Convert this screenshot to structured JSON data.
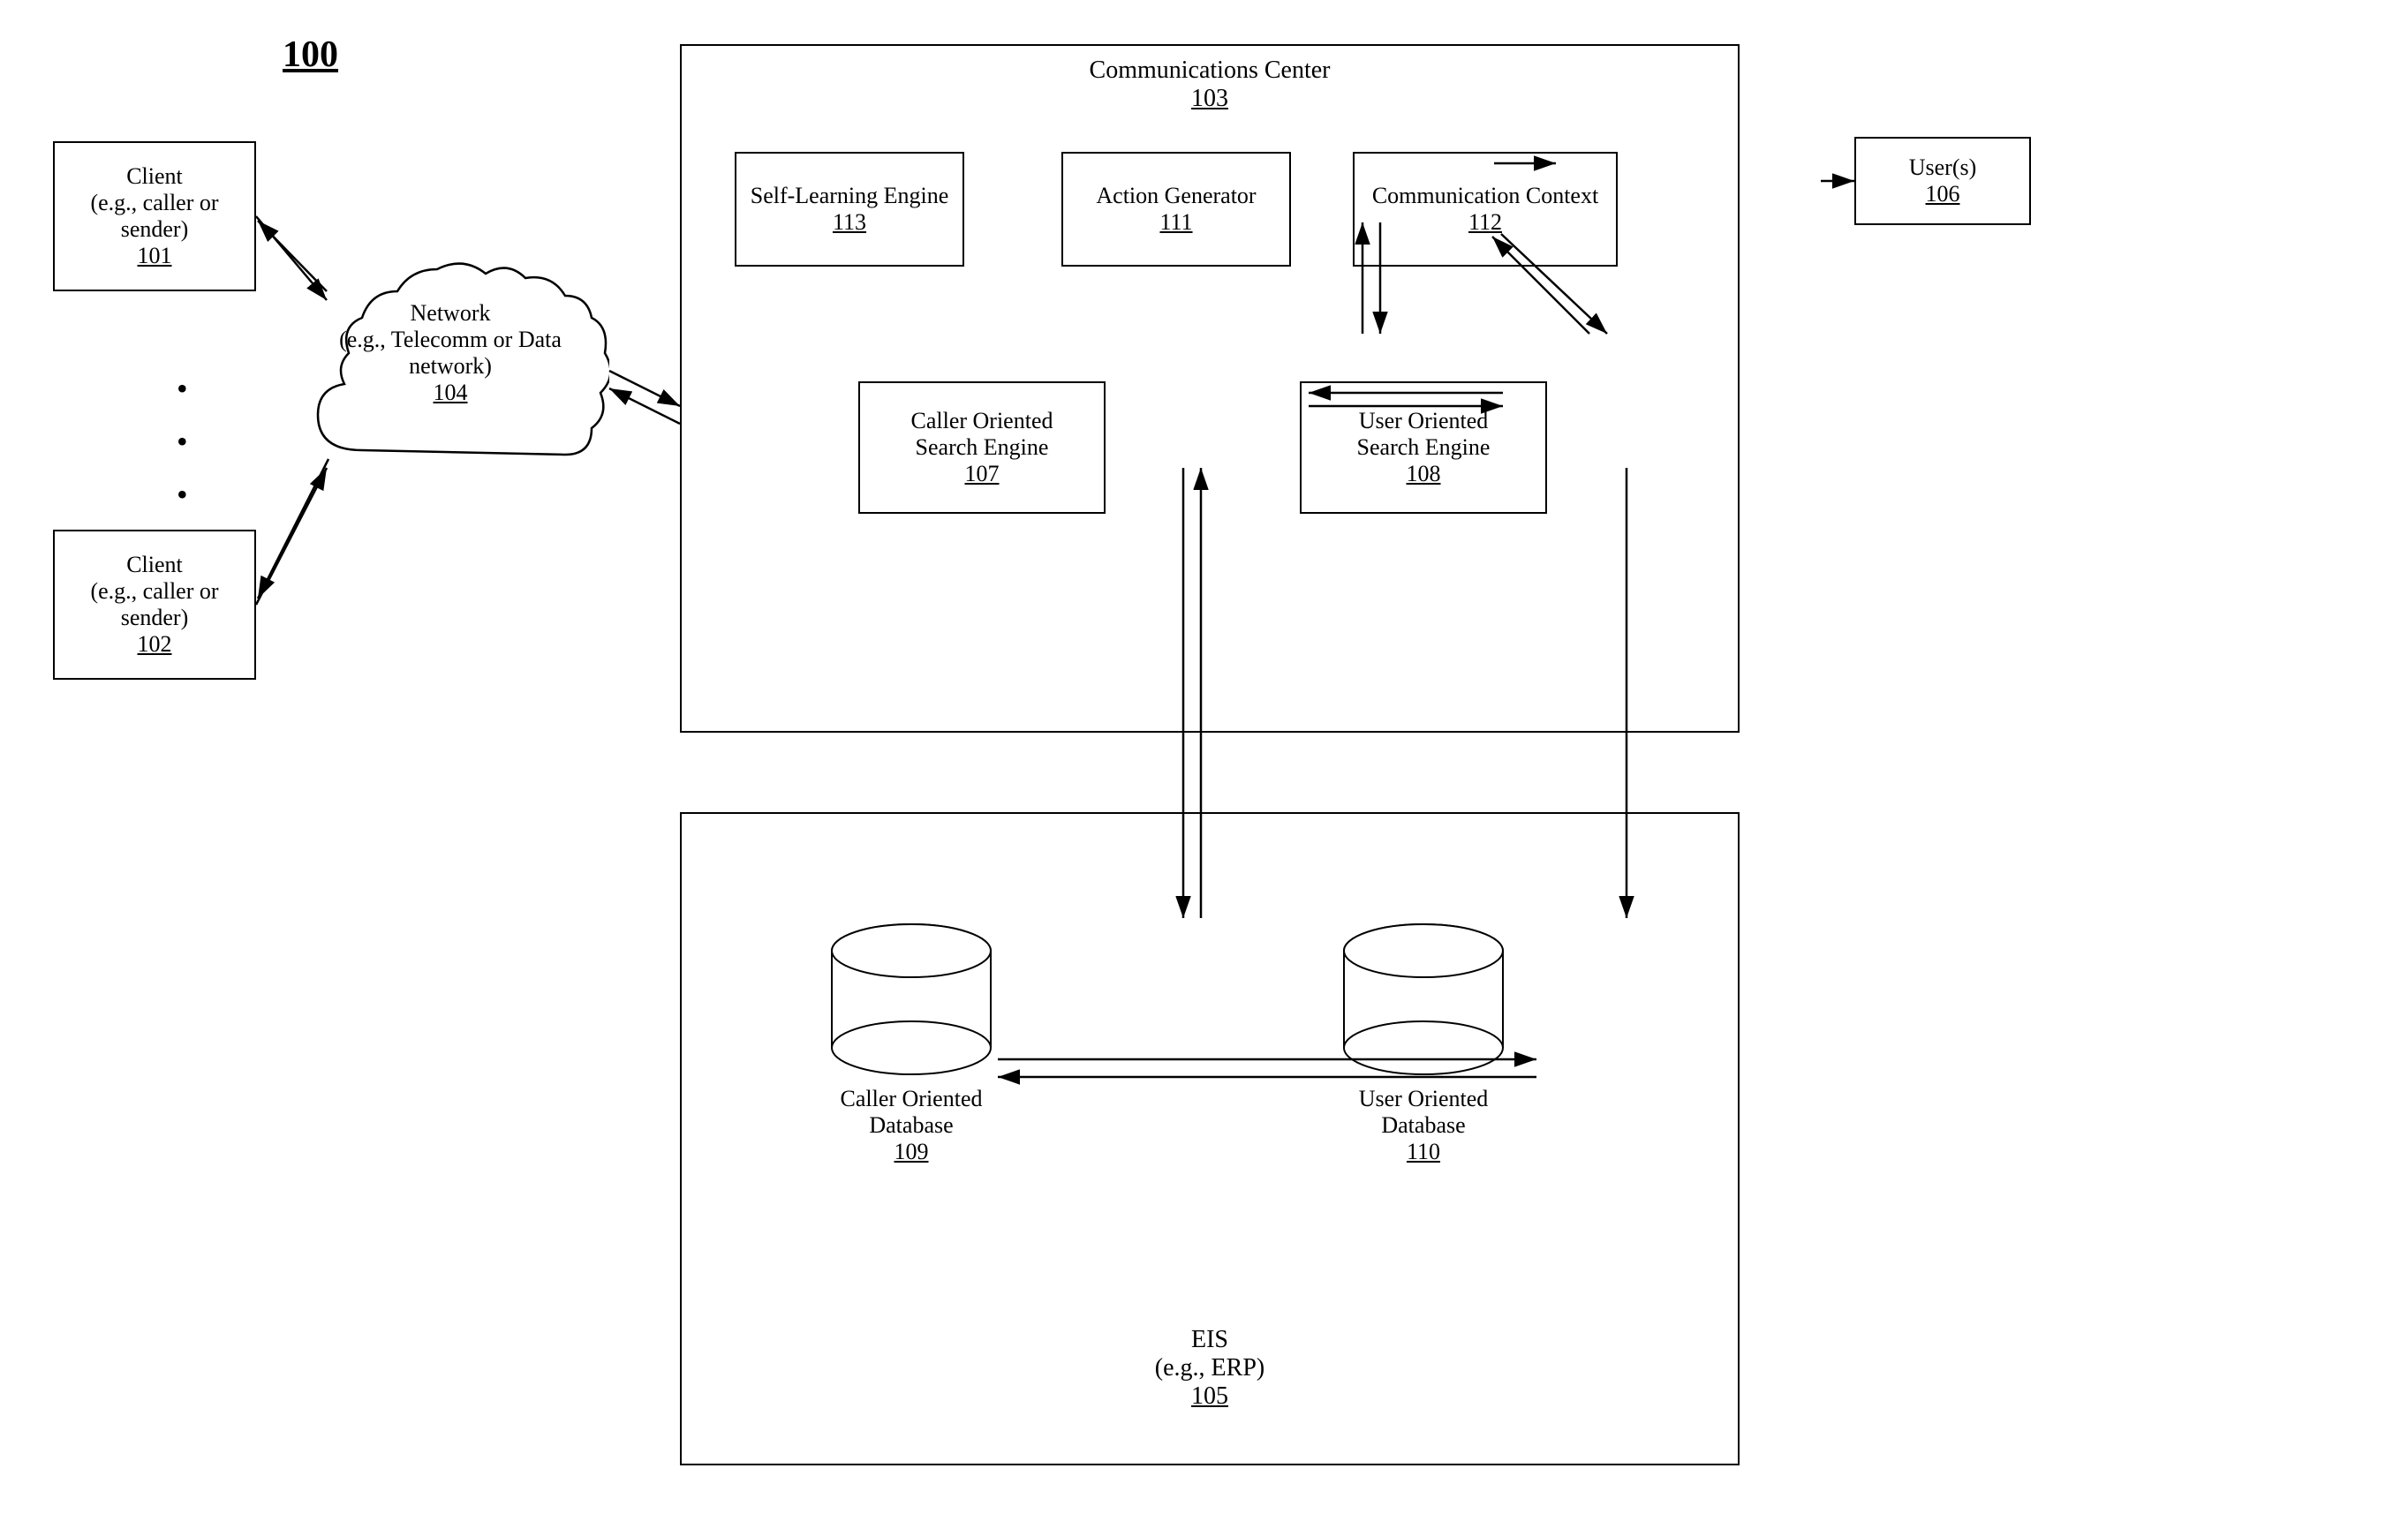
{
  "title": "100",
  "client1": {
    "line1": "Client",
    "line2": "(e.g., caller or",
    "line3": "sender)",
    "ref": "101"
  },
  "client2": {
    "line1": "Client",
    "line2": "(e.g., caller or",
    "line3": "sender)",
    "ref": "102"
  },
  "network": {
    "line1": "Network",
    "line2": "(e.g., Telecomm or Data",
    "line3": "network)",
    "ref": "104"
  },
  "commCenter": {
    "label": "Communications Center",
    "ref": "103"
  },
  "selfLearning": {
    "line1": "Self-Learning Engine",
    "ref": "113"
  },
  "actionGenerator": {
    "line1": "Action Generator",
    "ref": "111"
  },
  "commContext": {
    "line1": "Communication Context",
    "ref": "112"
  },
  "users": {
    "line1": "User(s)",
    "ref": "106"
  },
  "callerSearchEngine": {
    "line1": "Caller Oriented",
    "line2": "Search Engine",
    "ref": "107"
  },
  "userSearchEngine": {
    "line1": "User Oriented",
    "line2": "Search Engine",
    "ref": "108"
  },
  "eis": {
    "label": "EIS",
    "line2": "(e.g., ERP)",
    "ref": "105"
  },
  "callerDB": {
    "line1": "Caller Oriented",
    "line2": "Database",
    "ref": "109"
  },
  "userDB": {
    "line1": "User Oriented",
    "line2": "Database",
    "ref": "110"
  }
}
